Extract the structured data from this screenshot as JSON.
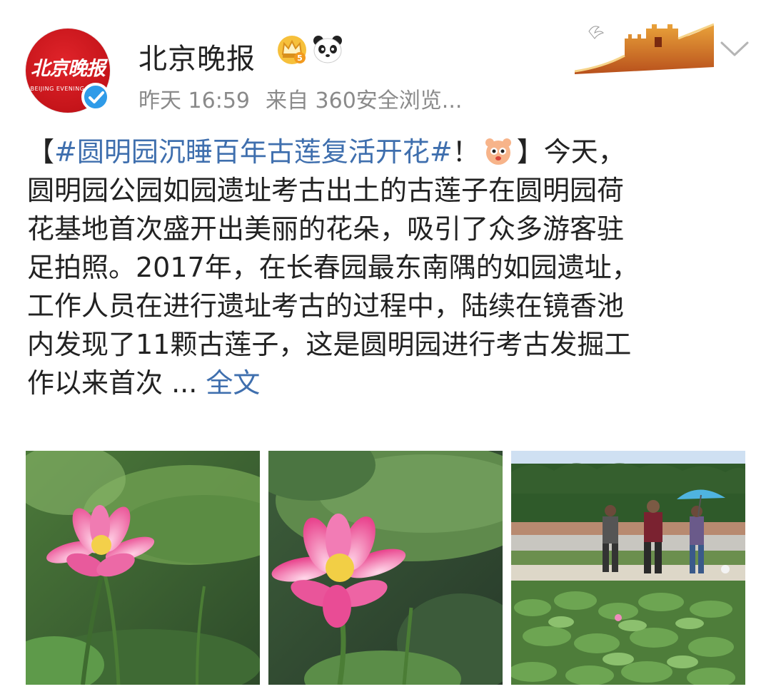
{
  "header": {
    "account_name": "北京晚报",
    "avatar_logo_text": "北京晚报",
    "avatar_logo_en": "BEIJING EVENING NEWS",
    "time": "昨天 16:59",
    "source": "来自 360安全浏览..."
  },
  "post": {
    "lines": [
      [
        "【",
        "#圆明园沉睡百年古莲复活开花#",
        "！",
        "】今天，"
      ],
      "圆明园公园如园遗址考古出土的古莲子在圆明园荷",
      "花基地首次盛开出美丽的花朵，吸引了众多游客驻",
      "足拍照。2017年，在长春园最东南隅的如园遗址，",
      "工作人员在进行遗址考古的过程中，陆续在镜香池",
      "内发现了11颗古莲子，这是圆明园进行考古发掘工",
      [
        "作以来首次 ... ",
        "全文"
      ]
    ]
  },
  "icons": {
    "verified": "verified-badge-icon",
    "crown": "crown-icon",
    "panda": "panda-icon",
    "emoji": "cute-emoji-icon",
    "chevron": "chevron-down-icon",
    "banner": "great-wall-banner"
  },
  "colors": {
    "link": "#3f6fae",
    "meta": "#8a8a8a",
    "avatar_red": "#c5141a",
    "verified_blue": "#2f9be8"
  },
  "photos": [
    {
      "name": "lotus-photo-1"
    },
    {
      "name": "lotus-photo-2"
    },
    {
      "name": "lotus-photo-3-visitors"
    }
  ]
}
